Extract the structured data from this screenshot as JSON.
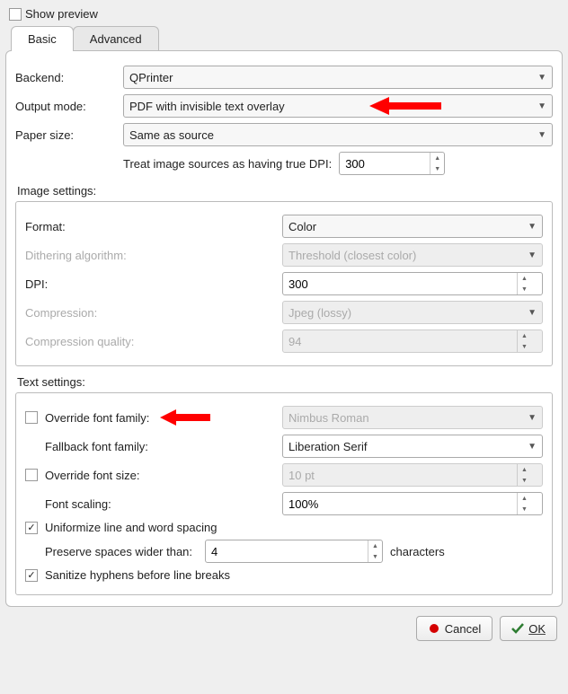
{
  "top": {
    "show_preview_label": "Show preview",
    "show_preview_checked": false
  },
  "tabs": {
    "basic": "Basic",
    "advanced": "Advanced",
    "active": "basic"
  },
  "basic": {
    "backend_label": "Backend:",
    "backend_value": "QPrinter",
    "output_mode_label": "Output mode:",
    "output_mode_value": "PDF with invisible text overlay",
    "paper_size_label": "Paper size:",
    "paper_size_value": "Same as source",
    "true_dpi_label": "Treat image sources as having true DPI:",
    "true_dpi_value": "300",
    "image_settings_title": "Image settings:",
    "image": {
      "format_label": "Format:",
      "format_value": "Color",
      "dither_label": "Dithering algorithm:",
      "dither_value": "Threshold (closest color)",
      "dpi_label": "DPI:",
      "dpi_value": "300",
      "compression_label": "Compression:",
      "compression_value": "Jpeg (lossy)",
      "quality_label": "Compression quality:",
      "quality_value": "94"
    },
    "text_settings_title": "Text settings:",
    "text": {
      "override_family_label": "Override font family:",
      "override_family_checked": false,
      "override_family_value": "Nimbus Roman",
      "fallback_family_label": "Fallback font family:",
      "fallback_family_value": "Liberation Serif",
      "override_size_label": "Override font size:",
      "override_size_checked": false,
      "override_size_value": "10 pt",
      "font_scaling_label": "Font scaling:",
      "font_scaling_value": "100%",
      "uniformize_label": "Uniformize line and word spacing",
      "uniformize_checked": true,
      "preserve_spaces_label": "Preserve spaces wider than:",
      "preserve_spaces_value": "4",
      "preserve_spaces_suffix": "characters",
      "sanitize_label": "Sanitize hyphens before line breaks",
      "sanitize_checked": true
    }
  },
  "buttons": {
    "cancel": "Cancel",
    "ok": "OK"
  },
  "annotations": {
    "arrow_color": "#ff0000"
  }
}
